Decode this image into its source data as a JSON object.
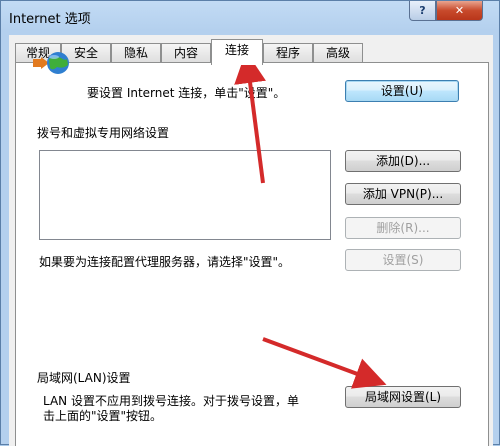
{
  "window": {
    "title": "Internet 选项",
    "help_label": "?",
    "close_label": "✕"
  },
  "tabs": [
    {
      "label": "常规"
    },
    {
      "label": "安全"
    },
    {
      "label": "隐私"
    },
    {
      "label": "内容"
    },
    {
      "label": "连接",
      "active": true
    },
    {
      "label": "程序"
    },
    {
      "label": "高级"
    }
  ],
  "connection": {
    "setup_text": "要设置 Internet 连接，单击\"设置\"。",
    "setup_button": "设置(U)",
    "dialup_heading": "拨号和虚拟专用网络设置",
    "add_button": "添加(D)...",
    "add_vpn_button": "添加 VPN(P)...",
    "remove_button": "删除(R)...",
    "proxy_text": "如果要为连接配置代理服务器，请选择\"设置\"。",
    "settings_button": "设置(S)",
    "lan_heading": "局域网(LAN)设置",
    "lan_text_line1": "LAN 设置不应用到拨号连接。对于拨号设置，单",
    "lan_text_line2": "击上面的\"设置\"按钮。",
    "lan_button": "局域网设置(L)"
  },
  "annotations": {
    "arrow_color": "#d42a2a",
    "icon": "network-globe-icon"
  }
}
